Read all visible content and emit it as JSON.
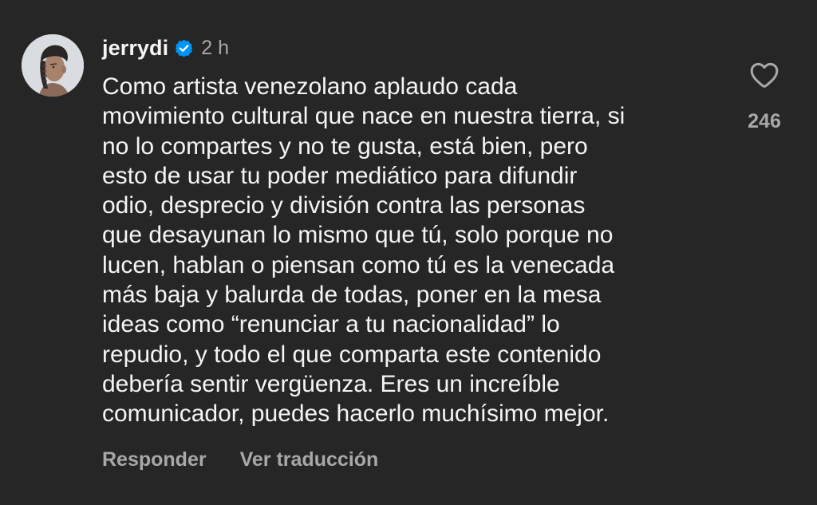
{
  "comment": {
    "username": "jerrydi",
    "verified_icon": "verified-badge-icon",
    "timestamp": "2 h",
    "lines": [
      "Como artista venezolano aplaudo cada",
      "movimiento cultural que nace en nuestra tierra, si",
      "no lo compartes y no te gusta, está bien, pero",
      "esto de usar tu poder mediático para difundir",
      "odio, desprecio y división contra las personas",
      "que desayunan lo mismo que tú, solo porque no",
      "lucen, hablan o piensan como tú es la venecada",
      "más baja y balurda de todas, poner en la mesa",
      "ideas como “renunciar a tu nacionalidad” lo",
      "repudio, y todo el que comparta este contenido",
      "debería sentir vergüenza. Eres un increíble",
      "comunicador, puedes hacerlo muchísimo mejor."
    ],
    "like_icon": "heart-icon",
    "like_count": "246",
    "reply_label": "Responder",
    "translate_label": "Ver traducción"
  },
  "colors": {
    "background": "#262626",
    "text_primary": "#f5f5f5",
    "text_secondary": "#a8a8a8",
    "verified_blue": "#0095f6"
  }
}
